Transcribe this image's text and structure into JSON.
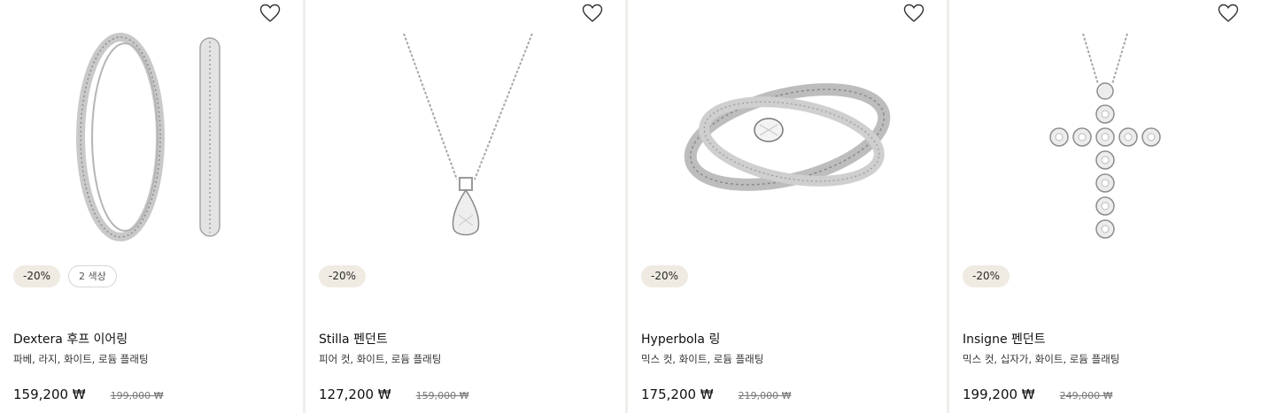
{
  "products": [
    {
      "discount": "-20%",
      "colors": "2 색상",
      "name": "Dextera 후프 이어링",
      "description": "파베, 라지, 화이트, 로듐 플래팅",
      "price": "159,200 ₩",
      "original_price": "199,000 ₩",
      "image_icon": "hoop-earrings-image",
      "wishlist_icon": "heart-outline-icon"
    },
    {
      "discount": "-20%",
      "name": "Stilla 펜던트",
      "description": "피어 컷, 화이트, 로듐 플래팅",
      "price": "127,200 ₩",
      "original_price": "159,000 ₩",
      "image_icon": "pear-pendant-image",
      "wishlist_icon": "heart-outline-icon"
    },
    {
      "discount": "-20%",
      "name": "Hyperbola 링",
      "description": "믹스 컷, 화이트, 로듐 플래팅",
      "price": "175,200 ₩",
      "original_price": "219,000 ₩",
      "image_icon": "crossover-ring-image",
      "wishlist_icon": "heart-outline-icon"
    },
    {
      "discount": "-20%",
      "name": "Insigne 펜던트",
      "description": "믹스 컷, 십자가, 화이트, 로듐 플래팅",
      "price": "199,200 ₩",
      "original_price": "249,000 ₩",
      "image_icon": "cross-pendant-image",
      "wishlist_icon": "heart-outline-icon"
    }
  ],
  "colors": {
    "background": "#f0eeea",
    "card": "#ffffff",
    "badge": "#efebe3"
  }
}
